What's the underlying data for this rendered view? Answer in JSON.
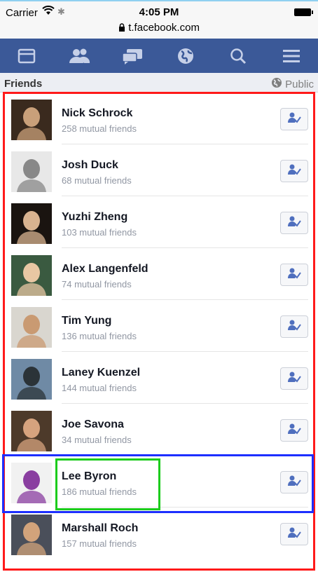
{
  "status_bar": {
    "carrier": "Carrier",
    "time": "4:05 PM",
    "url": "t.facebook.com"
  },
  "nav": {
    "items": [
      "feed",
      "friends",
      "messages",
      "notifications",
      "search",
      "menu"
    ]
  },
  "section": {
    "title": "Friends",
    "privacy": "Public"
  },
  "friends": [
    {
      "name": "Nick Schrock",
      "mutual": "258 mutual friends",
      "colors": [
        "#3a2a1e",
        "#c9a07a"
      ]
    },
    {
      "name": "Josh Duck",
      "mutual": "68 mutual friends",
      "colors": [
        "#e8e8e8",
        "#888888"
      ]
    },
    {
      "name": "Yuzhi Zheng",
      "mutual": "103 mutual friends",
      "colors": [
        "#1a1410",
        "#d8b390"
      ]
    },
    {
      "name": "Alex Langenfeld",
      "mutual": "74 mutual friends",
      "colors": [
        "#3a5a40",
        "#e8c7a3"
      ]
    },
    {
      "name": "Tim Yung",
      "mutual": "136 mutual friends",
      "colors": [
        "#d9d6cf",
        "#c99a72"
      ]
    },
    {
      "name": "Laney Kuenzel",
      "mutual": "144 mutual friends",
      "colors": [
        "#6f8aa5",
        "#2b3338"
      ]
    },
    {
      "name": "Joe Savona",
      "mutual": "34 mutual friends",
      "colors": [
        "#4d3a2a",
        "#d6a37e"
      ]
    },
    {
      "name": "Lee Byron",
      "mutual": "186 mutual friends",
      "colors": [
        "#f1f1f1",
        "#8a3ea0"
      ]
    },
    {
      "name": "Marshall Roch",
      "mutual": "157 mutual friends",
      "colors": [
        "#4a4f5a",
        "#d2a37b"
      ]
    }
  ],
  "colors": {
    "nav": "#3b5998",
    "button_icon": "#4f6fbe",
    "highlight_red": "#ff1a1a",
    "highlight_blue": "#1d2fff",
    "highlight_green": "#1ccc1c"
  },
  "icons": {
    "row_button": "add-friend-icon",
    "privacy": "globe-icon"
  }
}
